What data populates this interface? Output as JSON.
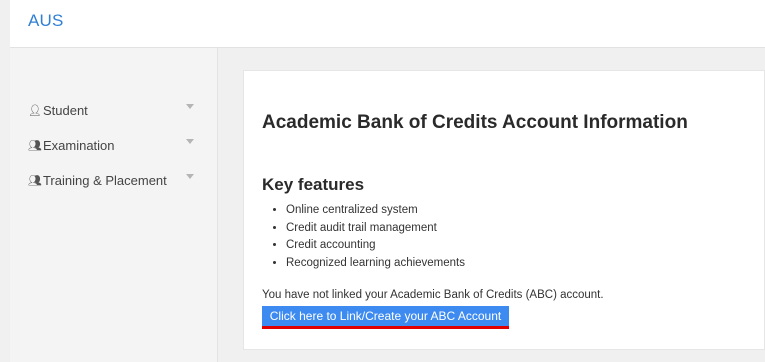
{
  "header": {
    "brand": "AUS"
  },
  "sidebar": {
    "items": [
      {
        "label": "Student",
        "icon": "user-icon"
      },
      {
        "label": "Examination",
        "icon": "users-icon"
      },
      {
        "label": "Training & Placement",
        "icon": "users-icon"
      }
    ]
  },
  "main": {
    "title": "Academic Bank of Credits Account Information",
    "features_heading": "Key features",
    "features": [
      "Online centralized system",
      "Credit audit trail management",
      "Credit accounting",
      "Recognized learning achievements"
    ],
    "notice": "You have not linked your Academic Bank of Credits (ABC) account.",
    "link_button": "Click here to Link/Create your ABC Account"
  },
  "colors": {
    "brand": "#2f7fd3",
    "button": "#3d8bf0",
    "underline": "#e00000"
  }
}
